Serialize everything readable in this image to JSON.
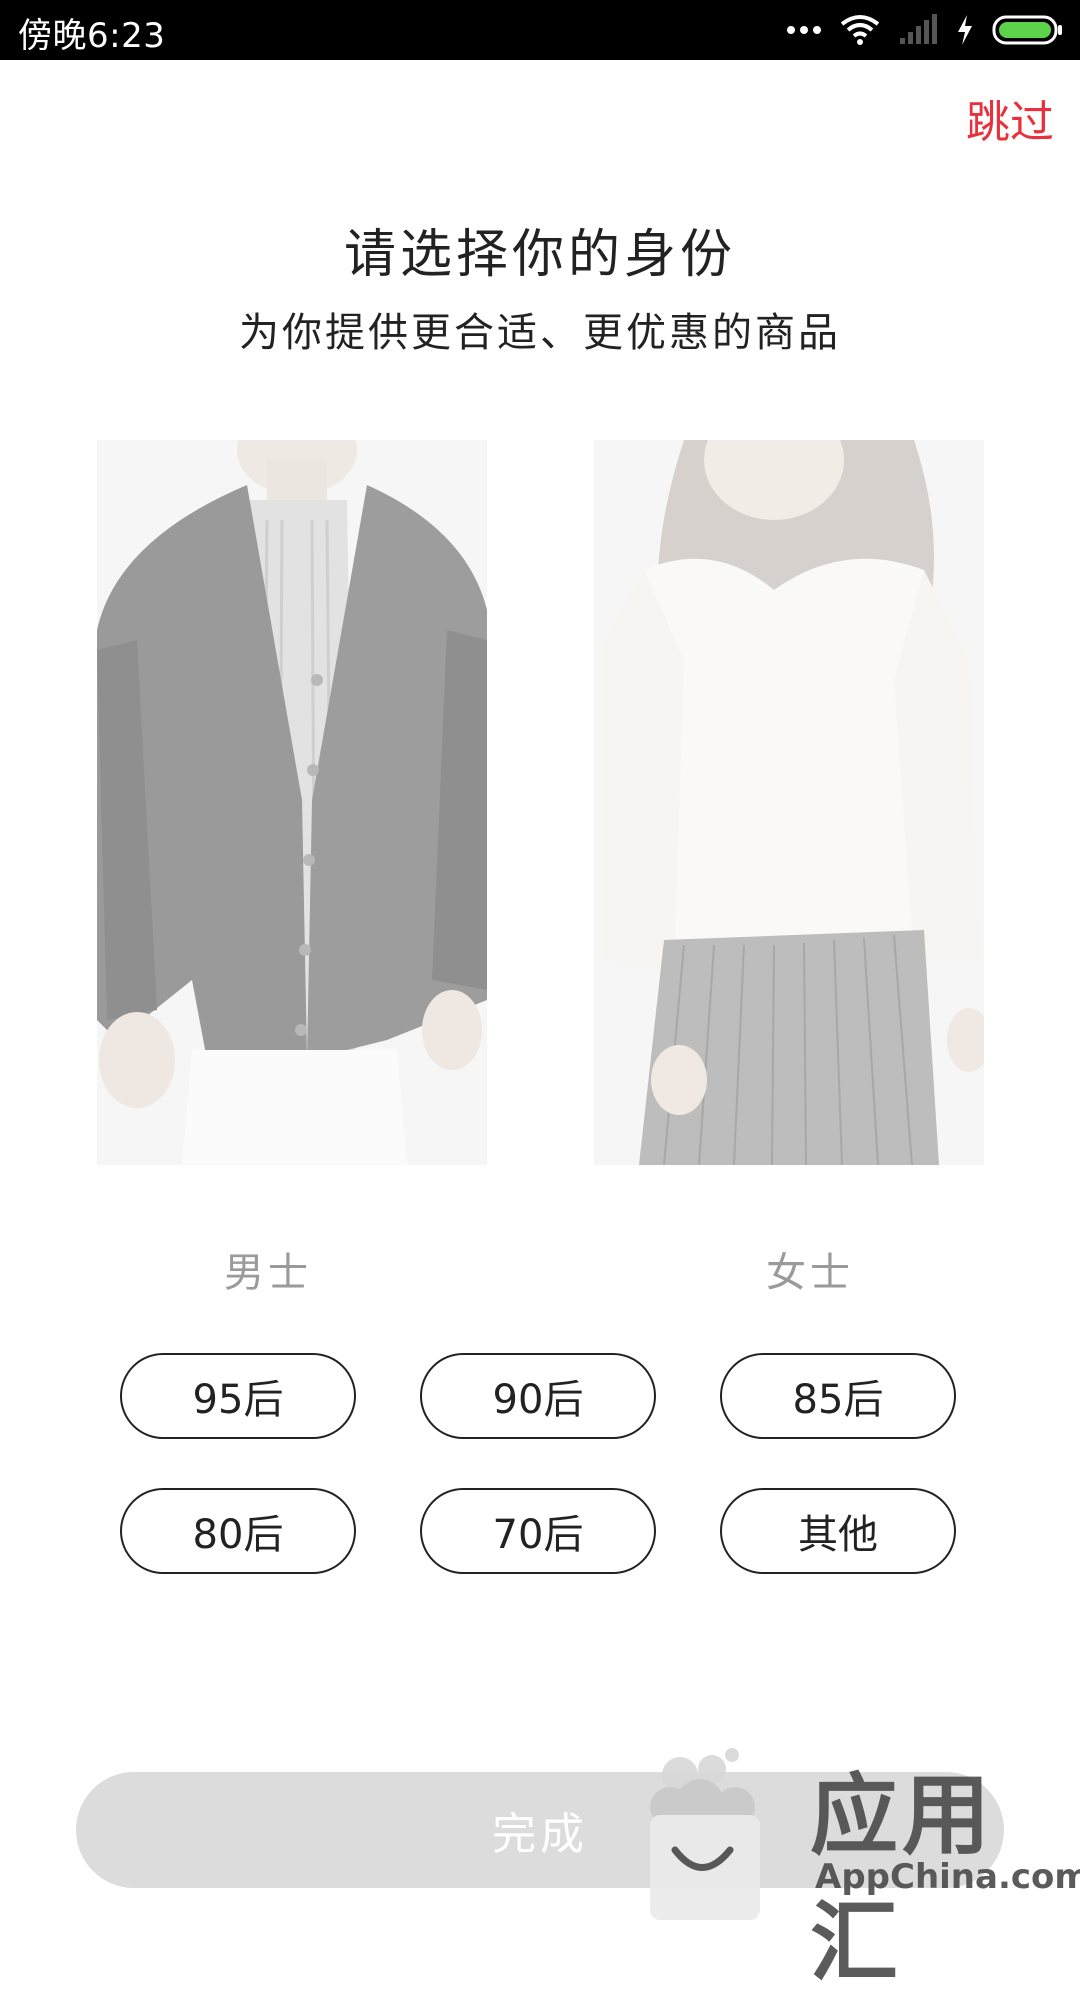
{
  "status_bar": {
    "time": "傍晚6:23"
  },
  "header": {
    "skip_label": "跳过"
  },
  "intro": {
    "title": "请选择你的身份",
    "subtitle": "为你提供更合适、更优惠的商品"
  },
  "genders": [
    {
      "label": "男士"
    },
    {
      "label": "女士"
    }
  ],
  "age_options": [
    {
      "label": "95后"
    },
    {
      "label": "90后"
    },
    {
      "label": "85后"
    },
    {
      "label": "80后"
    },
    {
      "label": "70后"
    },
    {
      "label": "其他"
    }
  ],
  "footer": {
    "done_label": "完成"
  },
  "watermark": {
    "brand": "应用汇",
    "site": "AppChina.com"
  },
  "colors": {
    "accent": "#e8313c",
    "done_bg": "#dcdcdc",
    "label_gray": "#9a9a9a"
  }
}
